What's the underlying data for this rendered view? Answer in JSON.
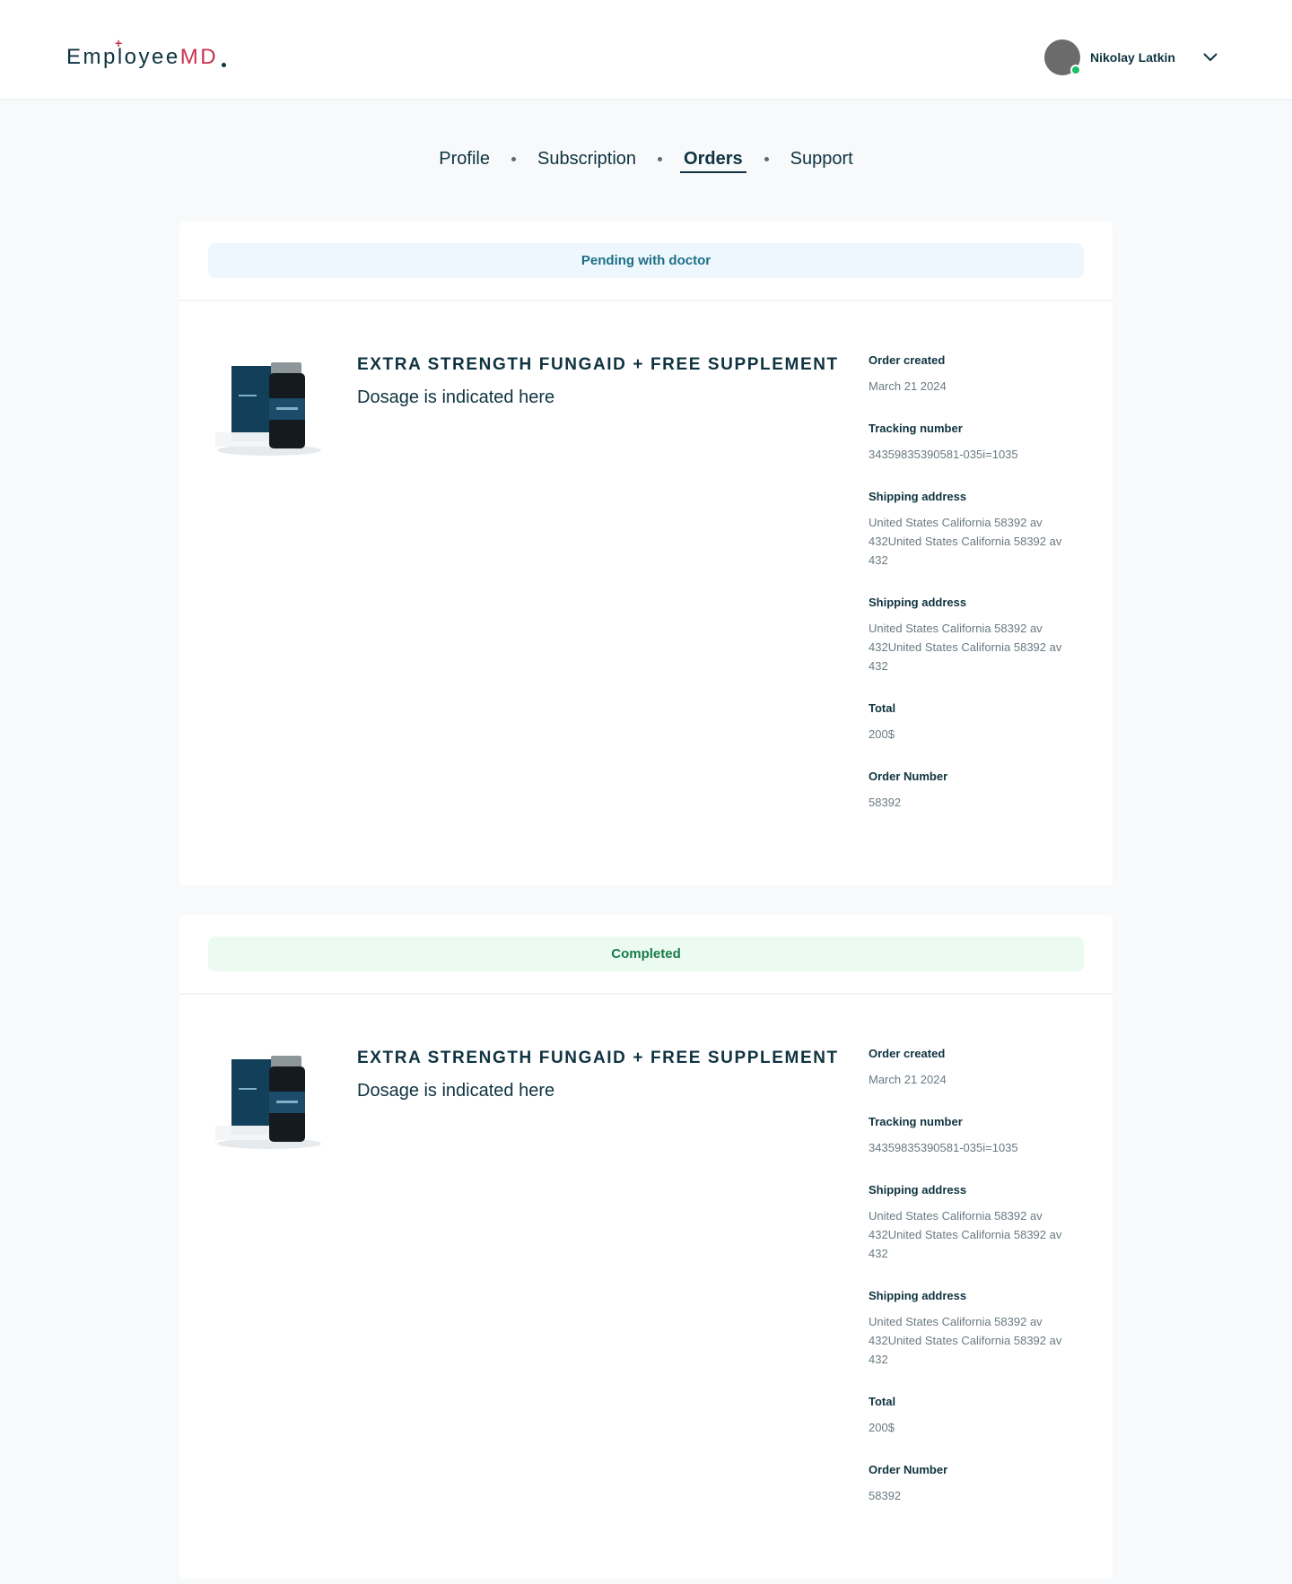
{
  "header": {
    "logo": {
      "main": "Employee",
      "accent": "MD",
      "plus": "+"
    },
    "user": {
      "name": "Nikolay Latkin"
    },
    "colors": {
      "brand": "#0f3340",
      "accent": "#c9334f",
      "online": "#1fbf6a"
    }
  },
  "tabs": [
    {
      "label": "Profile"
    },
    {
      "label": "Subscription"
    },
    {
      "label": "Orders"
    },
    {
      "label": "Support"
    }
  ],
  "orders": [
    {
      "status": "Pending with doctor",
      "product": {
        "title": "EXTRA STRENGTH FUNGAID + FREE SUPPLEMENT",
        "dosage": "Dosage is indicated here"
      },
      "details": [
        {
          "label": "Order created",
          "value": "March 21 2024"
        },
        {
          "label": "Tracking number",
          "value": "34359835390581-035i=1035"
        },
        {
          "label": "Shipping address",
          "value": "United States California 58392 av 432United States California 58392 av 432"
        },
        {
          "label": "Shipping address",
          "value": "United States California 58392 av 432United States California 58392 av 432"
        },
        {
          "label": "Total",
          "value": "200$"
        },
        {
          "label": "Order Number",
          "value": "58392"
        }
      ]
    },
    {
      "status": "Completed",
      "product": {
        "title": "EXTRA STRENGTH FUNGAID + FREE SUPPLEMENT",
        "dosage": "Dosage is indicated here"
      },
      "details": [
        {
          "label": "Order created",
          "value": "March 21 2024"
        },
        {
          "label": "Tracking number",
          "value": "34359835390581-035i=1035"
        },
        {
          "label": "Shipping address",
          "value": "United States California 58392 av 432United States California 58392 av 432"
        },
        {
          "label": "Shipping address",
          "value": "United States California 58392 av 432United States California 58392 av 432"
        },
        {
          "label": "Total",
          "value": "200$"
        },
        {
          "label": "Order Number",
          "value": "58392"
        }
      ]
    }
  ]
}
